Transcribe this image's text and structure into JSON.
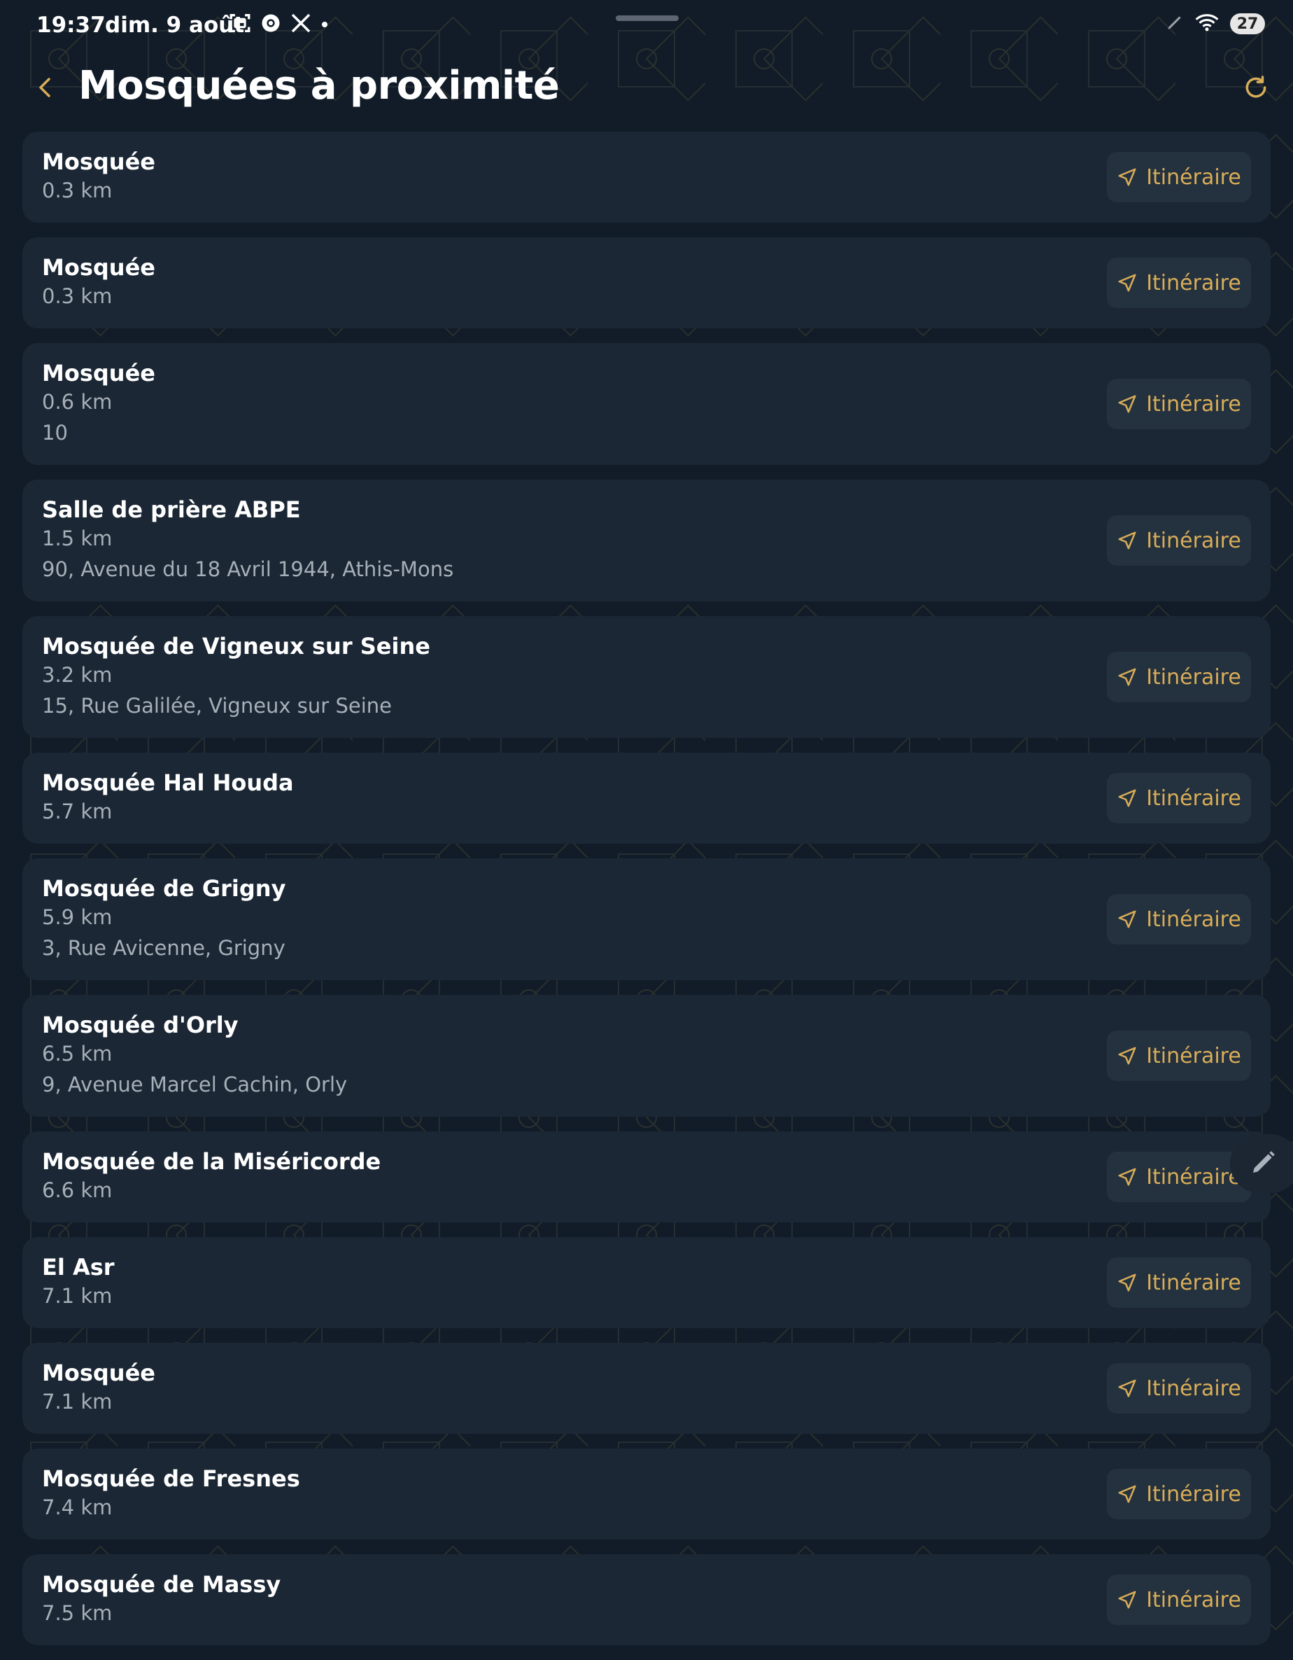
{
  "status_bar": {
    "time": "19:37",
    "date": "dim. 9 août",
    "battery": "27",
    "left_icons": [
      "screenshot-icon",
      "chrome-icon",
      "tools-icon",
      "dot-icon"
    ],
    "right_icons": [
      "pen-icon",
      "wifi-icon",
      "battery-icon"
    ]
  },
  "header": {
    "title": "Mosquées à proximité",
    "back_icon": "chevron-left-icon",
    "refresh_icon": "refresh-icon"
  },
  "colors": {
    "background": "#111c28",
    "card": "#1b2735",
    "button": "#24313f",
    "accent": "#d8ad58",
    "secondary_text": "#a7afb8"
  },
  "button_icon": "navigation-arrow-icon",
  "mosques": [
    {
      "name": "Mosquée",
      "distance": "0.3 km",
      "address": "",
      "button": "Itinéraire"
    },
    {
      "name": "Mosquée",
      "distance": "0.3 km",
      "address": "",
      "button": "Itinéraire"
    },
    {
      "name": "Mosquée",
      "distance": "0.6 km",
      "address": "10",
      "button": "Itinéraire"
    },
    {
      "name": "Salle de prière ABPE",
      "distance": "1.5 km",
      "address": "90, Avenue du 18 Avril 1944, Athis-Mons",
      "button": "Itinéraire"
    },
    {
      "name": "Mosquée de Vigneux sur Seine",
      "distance": "3.2 km",
      "address": "15, Rue Galilée, Vigneux sur Seine",
      "button": "Itinéraire"
    },
    {
      "name": "Mosquée Hal Houda",
      "distance": "5.7 km",
      "address": "",
      "button": "Itinéraire"
    },
    {
      "name": "Mosquée de Grigny",
      "distance": "5.9 km",
      "address": "3, Rue Avicenne, Grigny",
      "button": "Itinéraire"
    },
    {
      "name": "Mosquée d'Orly",
      "distance": "6.5 km",
      "address": "9, Avenue Marcel Cachin, Orly",
      "button": "Itinéraire"
    },
    {
      "name": "Mosquée de la Miséricorde",
      "distance": "6.6 km",
      "address": "",
      "button": "Itinéraire"
    },
    {
      "name": "El Asr",
      "distance": "7.1 km",
      "address": "",
      "button": "Itinéraire"
    },
    {
      "name": "Mosquée",
      "distance": "7.1 km",
      "address": "",
      "button": "Itinéraire"
    },
    {
      "name": "Mosquée de Fresnes",
      "distance": "7.4 km",
      "address": "",
      "button": "Itinéraire"
    },
    {
      "name": "Mosquée de Massy",
      "distance": "7.5 km",
      "address": "",
      "button": "Itinéraire"
    }
  ],
  "fab": {
    "icon": "pencil-icon"
  }
}
